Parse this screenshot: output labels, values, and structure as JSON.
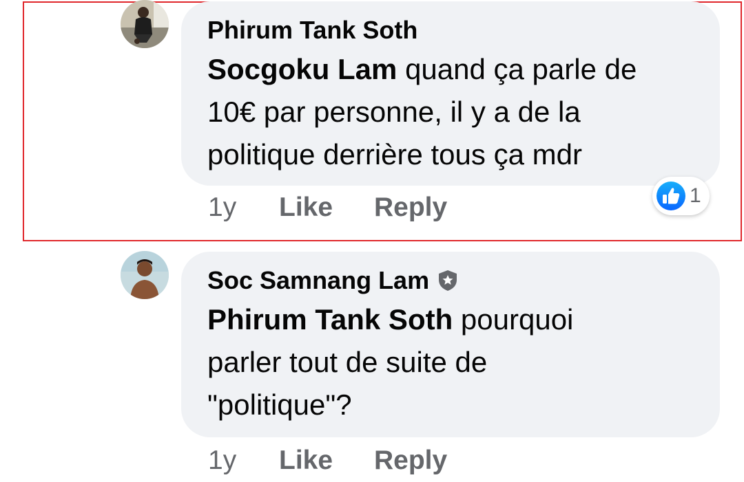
{
  "comments": [
    {
      "author": "Phirum Tank Soth",
      "mention": "Socgoku Lam",
      "text_line1": "quand ça parle de",
      "text_line2": "10€ par personne, il y a de la",
      "text_line3": "politique derrière tous ça mdr",
      "time": "1y",
      "like_label": "Like",
      "reply_label": "Reply",
      "reaction_icon": "thumbs-up-icon",
      "reaction_count": "1",
      "highlighted": true
    },
    {
      "author": "Soc Samnang Lam",
      "author_badge_icon": "shield-star-icon",
      "mention": "Phirum Tank Soth",
      "text_line1": "pourquoi",
      "text_line2": "parler tout de suite de",
      "text_line3": "\"politique\"?",
      "time": "1y",
      "like_label": "Like",
      "reply_label": "Reply"
    }
  ],
  "colors": {
    "highlight_border": "#e0262b",
    "bubble_bg": "#f0f2f5",
    "action_text": "#65676b",
    "like_blue": "#1877f2"
  }
}
